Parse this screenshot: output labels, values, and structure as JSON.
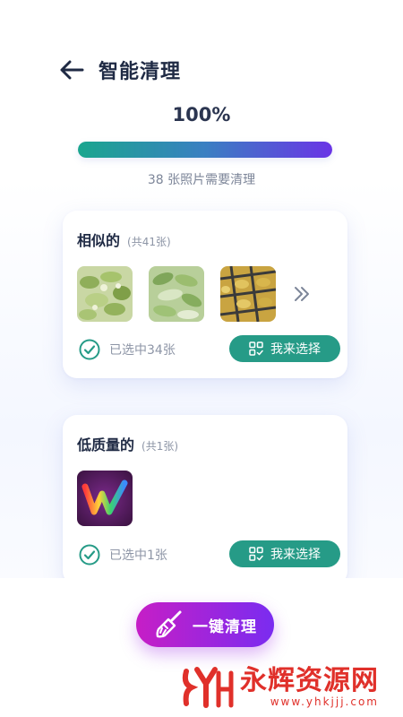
{
  "header": {
    "title": "智能清理"
  },
  "progress": {
    "text": "100%",
    "fraction": 1.0,
    "subtitle": "38 张照片需要清理"
  },
  "sections": [
    {
      "title": "相似的",
      "count": "(共41张)",
      "selected": "已选中34张",
      "choose": "我来选择"
    },
    {
      "title": "低质量的",
      "count": "(共1张)",
      "selected": "已选中1张",
      "choose": "我来选择"
    }
  ],
  "clean_button": {
    "label": "一键清理"
  },
  "watermark": {
    "title": "永辉资源网",
    "url": "www.yhkjjj.com"
  },
  "colors": {
    "accent_green": "#269b87",
    "progress_start": "#1aa68e",
    "progress_end": "#6a34e6",
    "clean_start": "#c61ec6",
    "clean_end": "#7a2cf0",
    "watermark": "#e0302a"
  }
}
